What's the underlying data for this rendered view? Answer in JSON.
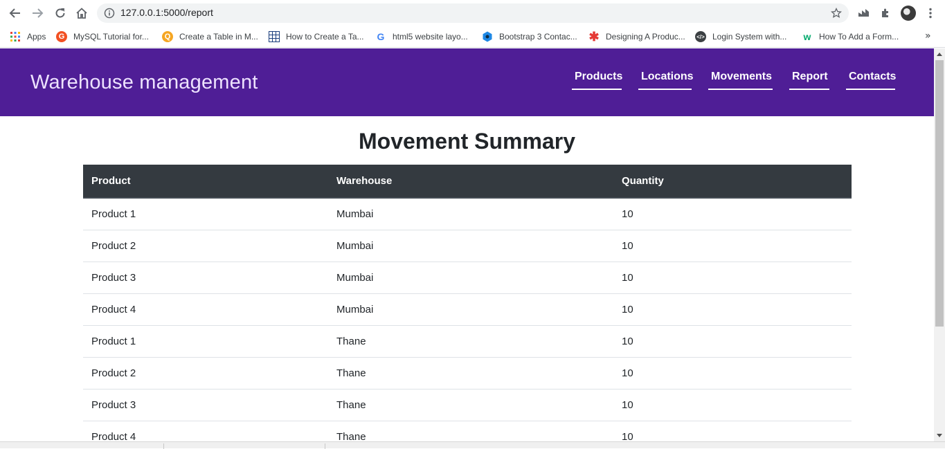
{
  "browser": {
    "url": "127.0.0.1:5000/report",
    "bookmarks": [
      {
        "label": "Apps",
        "icon": "apps-grid-icon"
      },
      {
        "label": "MySQL Tutorial for...",
        "icon": "mysql-tutorial-icon"
      },
      {
        "label": "Create a Table in M...",
        "icon": "search-q-icon"
      },
      {
        "label": "How to Create a Ta...",
        "icon": "table-grid-icon"
      },
      {
        "label": "html5 website layo...",
        "icon": "google-icon"
      },
      {
        "label": "Bootstrap 3 Contac...",
        "icon": "bootstrap-hex-icon"
      },
      {
        "label": "Designing A Produc...",
        "icon": "asterisk-icon"
      },
      {
        "label": "Login System with...",
        "icon": "code-brackets-icon"
      },
      {
        "label": "How To Add a Form...",
        "icon": "w3schools-icon"
      }
    ],
    "more_label": "»"
  },
  "site": {
    "brand": "Warehouse management",
    "nav": [
      "Products",
      "Locations",
      "Movements",
      "Report",
      "Contacts"
    ]
  },
  "report": {
    "title": "Movement Summary",
    "columns": [
      "Product",
      "Warehouse",
      "Quantity"
    ],
    "rows": [
      [
        "Product 1",
        "Mumbai",
        "10"
      ],
      [
        "Product 2",
        "Mumbai",
        "10"
      ],
      [
        "Product 3",
        "Mumbai",
        "10"
      ],
      [
        "Product 4",
        "Mumbai",
        "10"
      ],
      [
        "Product 1",
        "Thane",
        "10"
      ],
      [
        "Product 2",
        "Thane",
        "10"
      ],
      [
        "Product 3",
        "Thane",
        "10"
      ],
      [
        "Product 4",
        "Thane",
        "10"
      ]
    ]
  },
  "colors": {
    "header_bg": "#4f1e96",
    "brand_text": "#ede2ff",
    "table_head_bg": "#343a40"
  }
}
